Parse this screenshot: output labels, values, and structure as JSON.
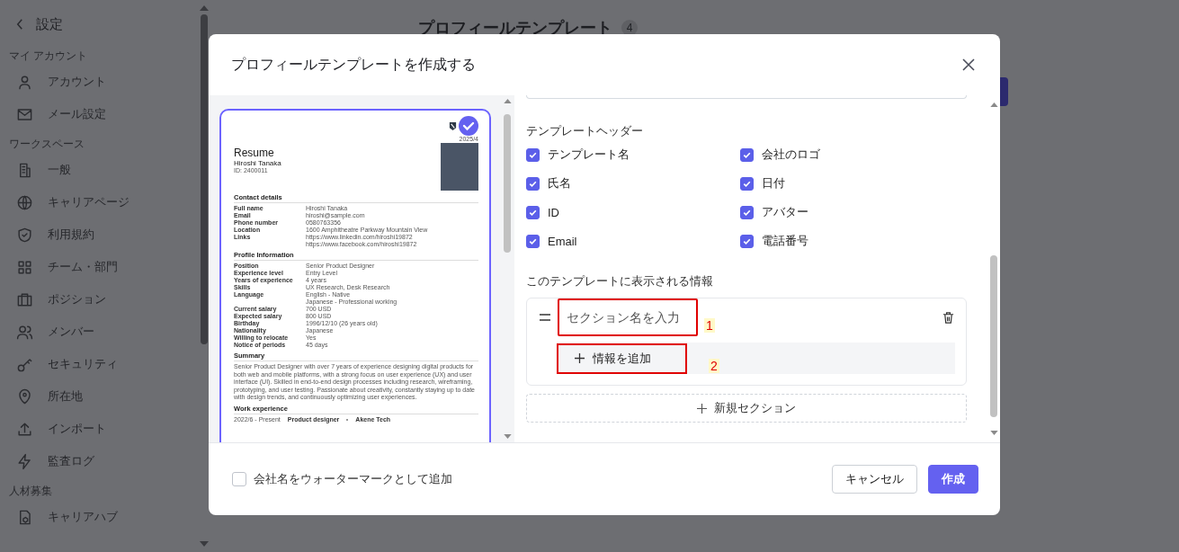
{
  "sidebar": {
    "back_label": "設定",
    "sections": [
      {
        "heading": "マイ アカウント",
        "items": [
          {
            "label": "アカウント"
          },
          {
            "label": "メール設定"
          }
        ]
      },
      {
        "heading": "ワークスペース",
        "items": [
          {
            "label": "一般"
          },
          {
            "label": "キャリアページ"
          },
          {
            "label": "利用規約"
          },
          {
            "label": "チーム・部門"
          },
          {
            "label": "ポジション"
          },
          {
            "label": "メンバー"
          },
          {
            "label": "セキュリティ"
          },
          {
            "label": "所在地"
          },
          {
            "label": "インポート"
          },
          {
            "label": "監査ログ"
          }
        ]
      },
      {
        "heading": "人材募集",
        "items": [
          {
            "label": "キャリアハブ"
          }
        ]
      }
    ]
  },
  "page": {
    "title": "プロフィールテンプレート",
    "count": "4"
  },
  "modal": {
    "title": "プロフィールテンプレートを作成する",
    "resume": {
      "date": "2025/4",
      "title": "Resume",
      "name": "Hiroshi Tanaka",
      "id": "ID: 2400011",
      "sections": [
        {
          "heading": "Contact details",
          "rows": [
            {
              "label": "Full name",
              "values": [
                "Hiroshi Tanaka"
              ]
            },
            {
              "label": "Email",
              "values": [
                "hiroshi@sample.com"
              ]
            },
            {
              "label": "Phone number",
              "values": [
                "0580763356"
              ]
            },
            {
              "label": "Location",
              "values": [
                "1600 Amphitheatre Parkway Mountain View"
              ]
            },
            {
              "label": "Links",
              "values": [
                "https://www.linkedin.com/hiroshi19872",
                "https://www.facebook.com/hiroshi19872"
              ]
            }
          ]
        },
        {
          "heading": "Profile Information",
          "rows": [
            {
              "label": "Position",
              "values": [
                "Senior Product Designer"
              ]
            },
            {
              "label": "Experience level",
              "values": [
                "Entry Level"
              ]
            },
            {
              "label": "Years of experience",
              "values": [
                "4 years"
              ]
            },
            {
              "label": "Skills",
              "values": [
                "UX Research, Desk Research"
              ]
            },
            {
              "label": "Language",
              "values": [
                "English - Native",
                "Japanese - Professional working"
              ]
            },
            {
              "label": "Current salary",
              "values": [
                "700 USD"
              ]
            },
            {
              "label": "Expected salary",
              "values": [
                "800 USD"
              ]
            },
            {
              "label": "Birthday",
              "values": [
                "1996/12/10 (26 years old)"
              ]
            },
            {
              "label": "Nationality",
              "values": [
                "Japanese"
              ]
            },
            {
              "label": "Willing to relocate",
              "values": [
                "Yes"
              ]
            },
            {
              "label": "Notice of periods",
              "values": [
                "45 days"
              ]
            }
          ]
        }
      ],
      "summary_heading": "Summary",
      "summary": "Senior Product Designer with over 7 years of experience designing digital products for both web and mobile platforms, with a strong focus on user experience (UX) and user interface (UI). Skilled in end-to-end design processes including research, wireframing, prototyping, and user testing. Passionate about creativity, constantly staying up to date with design trends, and continuously optimizing user experiences.",
      "work_heading": "Work experience",
      "work": [
        {
          "period": "2022/6 - Present",
          "role": "Product designer",
          "company": "Akene Tech"
        }
      ]
    },
    "template_header": {
      "label": "テンプレートヘッダー",
      "options": [
        {
          "label": "テンプレート名",
          "checked": true
        },
        {
          "label": "会社のロゴ",
          "checked": true
        },
        {
          "label": "氏名",
          "checked": true
        },
        {
          "label": "日付",
          "checked": true
        },
        {
          "label": "ID",
          "checked": true
        },
        {
          "label": "アバター",
          "checked": true
        },
        {
          "label": "Email",
          "checked": true
        },
        {
          "label": "電話番号",
          "checked": true
        }
      ]
    },
    "info": {
      "label": "このテンプレートに表示される情報",
      "sections": [
        {
          "name_placeholder": "セクション名を入力",
          "name_annotation": "1",
          "add_label": "情報を追加",
          "add_annotation": "2"
        }
      ],
      "new_section": "新規セクション"
    },
    "footer": {
      "watermark": {
        "label": "会社名をウォーターマークとして追加",
        "checked": false
      },
      "cancel": "キャンセル",
      "create": "作成"
    }
  }
}
